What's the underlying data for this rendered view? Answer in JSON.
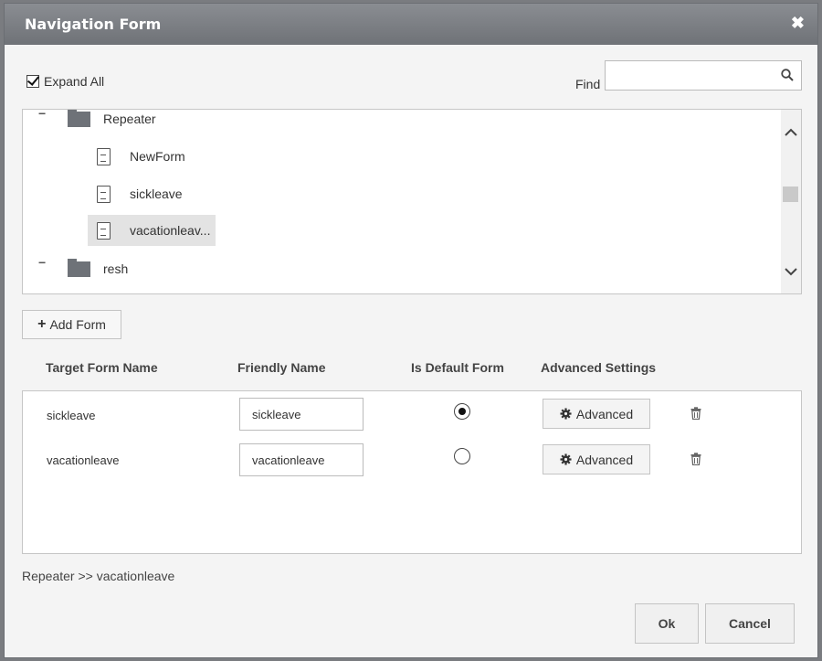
{
  "dialog": {
    "title": "Navigation Form",
    "close_icon": "close-icon"
  },
  "toolbar": {
    "expand_all_label": "Expand All",
    "expand_all_checked": true,
    "find_label": "Find",
    "find_value": "",
    "find_placeholder": ""
  },
  "tree": {
    "items": [
      {
        "type": "folder",
        "label": "Repeater",
        "toggle": "−"
      },
      {
        "type": "form",
        "label": "NewForm"
      },
      {
        "type": "form",
        "label": "sickleave"
      },
      {
        "type": "form",
        "label": "vacationleav...",
        "selected": true
      },
      {
        "type": "folder",
        "label": "resh",
        "toggle": "−"
      }
    ]
  },
  "add_form": {
    "label": "Add Form"
  },
  "table": {
    "columns": [
      "Target Form Name",
      "Friendly Name",
      "Is Default Form",
      "Advanced Settings"
    ],
    "rows": [
      {
        "target": "sickleave",
        "friendly": "sickleave",
        "is_default": true,
        "advanced_label": "Advanced"
      },
      {
        "target": "vacationleave",
        "friendly": "vacationleave",
        "is_default": false,
        "advanced_label": "Advanced"
      }
    ]
  },
  "breadcrumb": "Repeater >> vacationleave",
  "footer": {
    "ok_label": "Ok",
    "cancel_label": "Cancel"
  }
}
